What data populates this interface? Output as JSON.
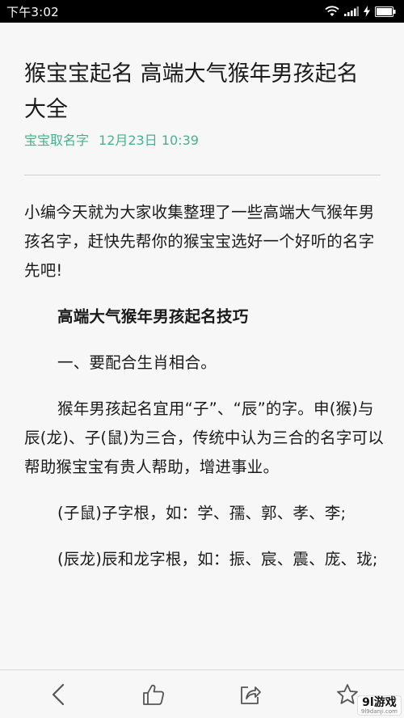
{
  "status_bar": {
    "time": "下午3:02"
  },
  "article": {
    "title": "猴宝宝起名 高端大气猴年男孩起名大全",
    "source": "宝宝取名字",
    "date": "12月23日 10:39",
    "paragraphs": [
      "小编今天就为大家收集整理了一些高端大气猴年男孩名字，赶快先帮你的猴宝宝选好一个好听的名字先吧!",
      "高端大气猴年男孩起名技巧",
      "一、要配合生肖相合。",
      "猴年男孩起名宜用“子”、“辰”的字。申(猴)与辰(龙)、子(鼠)为三合，传统中认为三合的名字可以帮助猴宝宝有贵人帮助，增进事业。",
      "(子鼠)子字根，如：学、孺、郭、孝、李;",
      "(辰龙)辰和龙字根，如：振、宸、震、庞、珑;"
    ]
  },
  "toolbar": {
    "icons": [
      "back-icon",
      "thumbs-up-icon",
      "share-icon",
      "star-icon"
    ]
  },
  "watermark": {
    "main": "9l游戏",
    "sub": "9l9danji.com"
  },
  "colors": {
    "accent": "#4ab08c",
    "status_bar_bg": "#000000",
    "page_bg": "#f7f7f7"
  }
}
